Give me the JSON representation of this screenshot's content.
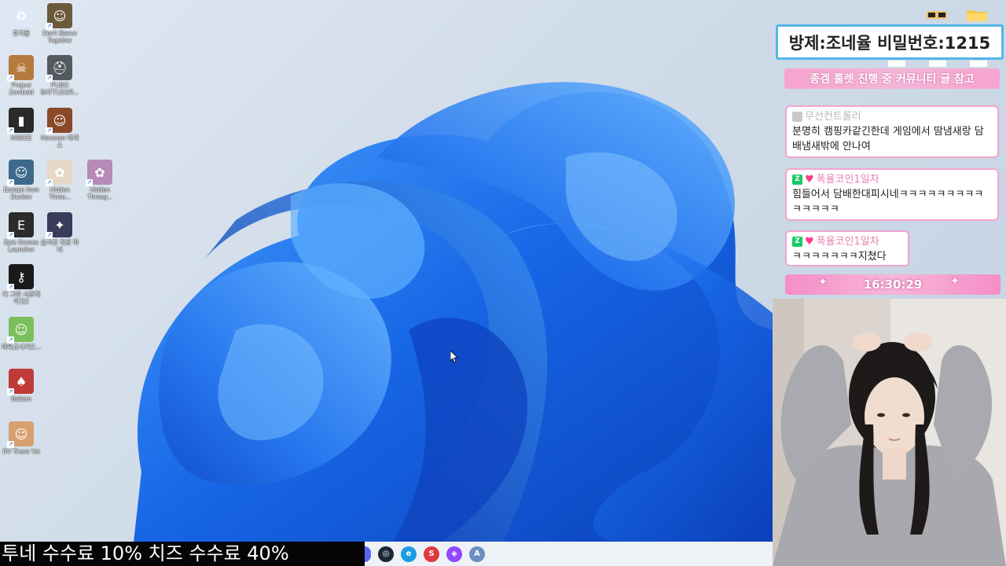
{
  "desktop_icons": [
    {
      "label": "휴지통",
      "icon": "recycle-bin-icon",
      "color": "#dfe9f5"
    },
    {
      "label": "Don't Starve Together",
      "icon": "dont-starve-icon",
      "color": "#6b5a3a"
    },
    {
      "label": "Project Zomboid",
      "icon": "project-zomboid-icon",
      "color": "#b67a3e"
    },
    {
      "label": "PUBG BATTLEGR...",
      "icon": "pubg-icon",
      "color": "#555a60"
    },
    {
      "label": "INSIDE",
      "icon": "inside-icon",
      "color": "#2a2a2a"
    },
    {
      "label": "Necesse 네세스",
      "icon": "necesse-icon",
      "color": "#8a4a2a"
    },
    {
      "label": "Escape from Duckov",
      "icon": "escape-from-duckov-icon",
      "color": "#3d6a8a"
    },
    {
      "label": "Hidden Throu...",
      "icon": "hidden-through-icon-1",
      "color": "#e8d8c8"
    },
    {
      "label": "Hidden Throug...",
      "icon": "hidden-through-icon-2",
      "color": "#b88ab8"
    },
    {
      "label": "Epic Games Launcher",
      "icon": "epic-games-icon",
      "color": "#2b2b2b"
    },
    {
      "label": "숨겨진 작은 마녀",
      "icon": "little-witch-icon",
      "color": "#3a3a5a"
    },
    {
      "label": "더 그린 시즌레이크2",
      "icon": "keyhole-game-icon",
      "color": "#1a1a1a"
    },
    {
      "label": "체육교사키드...",
      "icon": "pixel-game-icon",
      "color": "#7ac05a"
    },
    {
      "label": "Balatro",
      "icon": "balatro-icon",
      "color": "#c03a3a"
    },
    {
      "label": "RV There Yet",
      "icon": "rv-there-yet-icon",
      "color": "#d8a070"
    }
  ],
  "overlay": {
    "password_banner": "방제:조네율 비밀번호:1215",
    "notice_banner": "종겜 룰렛 진행 중 커뮤니티 글 참고",
    "time": "16:30:29"
  },
  "chat": [
    {
      "user": "무선컨트롤러",
      "message": "분명히 캠핑카같긴한데 게임에서 땀냄새랑 담배냄새밖에 안나여",
      "badge": "none"
    },
    {
      "user": "폭율코인1일차",
      "message": "힘들어서 담배한대피시네ㅋㅋㅋㅋㅋㅋㅋㅋㅋㅋㅋㅋㅋㅋ",
      "badge": "z-heart"
    },
    {
      "user": "폭율코인1일차",
      "message": "ㅋㅋㅋㅋㅋㅋㅋ지쳤다",
      "badge": "z-heart"
    }
  ],
  "caption": "투네 수수료 10% 치즈 수수료 40%",
  "taskbar": [
    {
      "icon": "discord-icon",
      "color": "#5865f2"
    },
    {
      "icon": "steam-icon",
      "color": "#1b2838"
    },
    {
      "icon": "edge-icon",
      "color": "#1b9de2"
    },
    {
      "icon": "soop-icon",
      "color": "#e0383e"
    },
    {
      "icon": "twitch-icon",
      "color": "#9146ff"
    },
    {
      "icon": "app-icon",
      "color": "#6c8ebf"
    }
  ],
  "colors": {
    "wallpaper_blue": "#1a6fe8",
    "overlay_pink": "#f6a4cf",
    "password_border": "#53b6e8"
  }
}
